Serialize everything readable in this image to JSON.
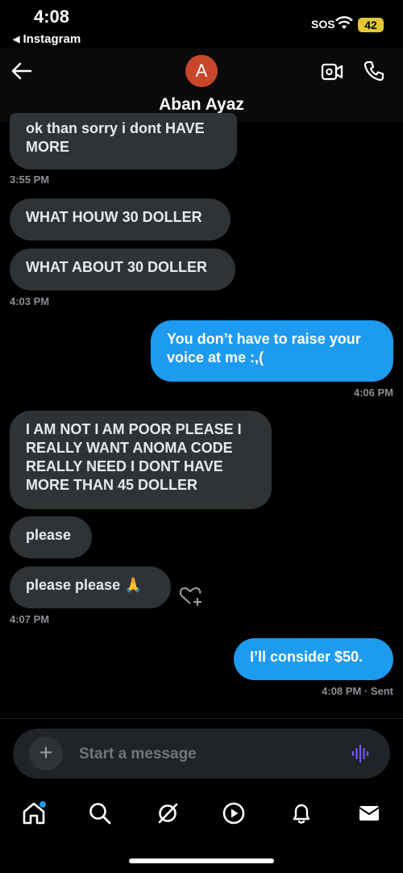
{
  "status_bar": {
    "time": "4:08",
    "back_label": "Instagram",
    "sos": "SOS",
    "battery": "42"
  },
  "header": {
    "avatar_letter": "A",
    "contact_name": "Aban Ayaz"
  },
  "messages": [
    {
      "text": "ok than sorry i dont HAVE\nMORE",
      "direction": "incoming"
    },
    {
      "text": "3:55 PM",
      "type": "timestamp"
    },
    {
      "text": "WHAT HOUW 30 DOLLER",
      "direction": "incoming"
    },
    {
      "text": "WHAT ABOUT 30 DOLLER",
      "direction": "incoming"
    },
    {
      "text": "4:03 PM",
      "type": "timestamp"
    },
    {
      "text": "You don’t have to raise your voice at me :,(",
      "direction": "outgoing"
    },
    {
      "text": "4:06 PM",
      "type": "timestamp"
    },
    {
      "text": "I AM NOT I AM POOR PLEASE I REALLY WANT ANOMA CODE REALLY NEED I DONT HAVE MORE THAN 45 DOLLER",
      "direction": "incoming"
    },
    {
      "text": "please",
      "direction": "incoming"
    },
    {
      "text": "please please 🙏",
      "direction": "incoming"
    },
    {
      "text": "4:07 PM",
      "type": "timestamp"
    },
    {
      "text": "I’ll consider $50.",
      "direction": "outgoing"
    },
    {
      "text": "4:08 PM · Sent",
      "type": "timestamp"
    }
  ],
  "composer": {
    "placeholder": "Start a message"
  },
  "icons": {
    "back": "arrow-left-icon",
    "video": "video-call-icon",
    "phone": "phone-icon",
    "react": "heart-plus-icon",
    "mic": "voice-wave-icon",
    "tabs": [
      "home-icon",
      "search-icon",
      "grok-icon",
      "play-icon",
      "bell-icon",
      "mail-icon"
    ]
  },
  "colors": {
    "outgoing_bubble": "#1d9bf0",
    "incoming_bubble": "#2f3336",
    "avatar": "#c8462a",
    "mic": "#7856ff",
    "notification_dot": "#1d9bf0"
  }
}
